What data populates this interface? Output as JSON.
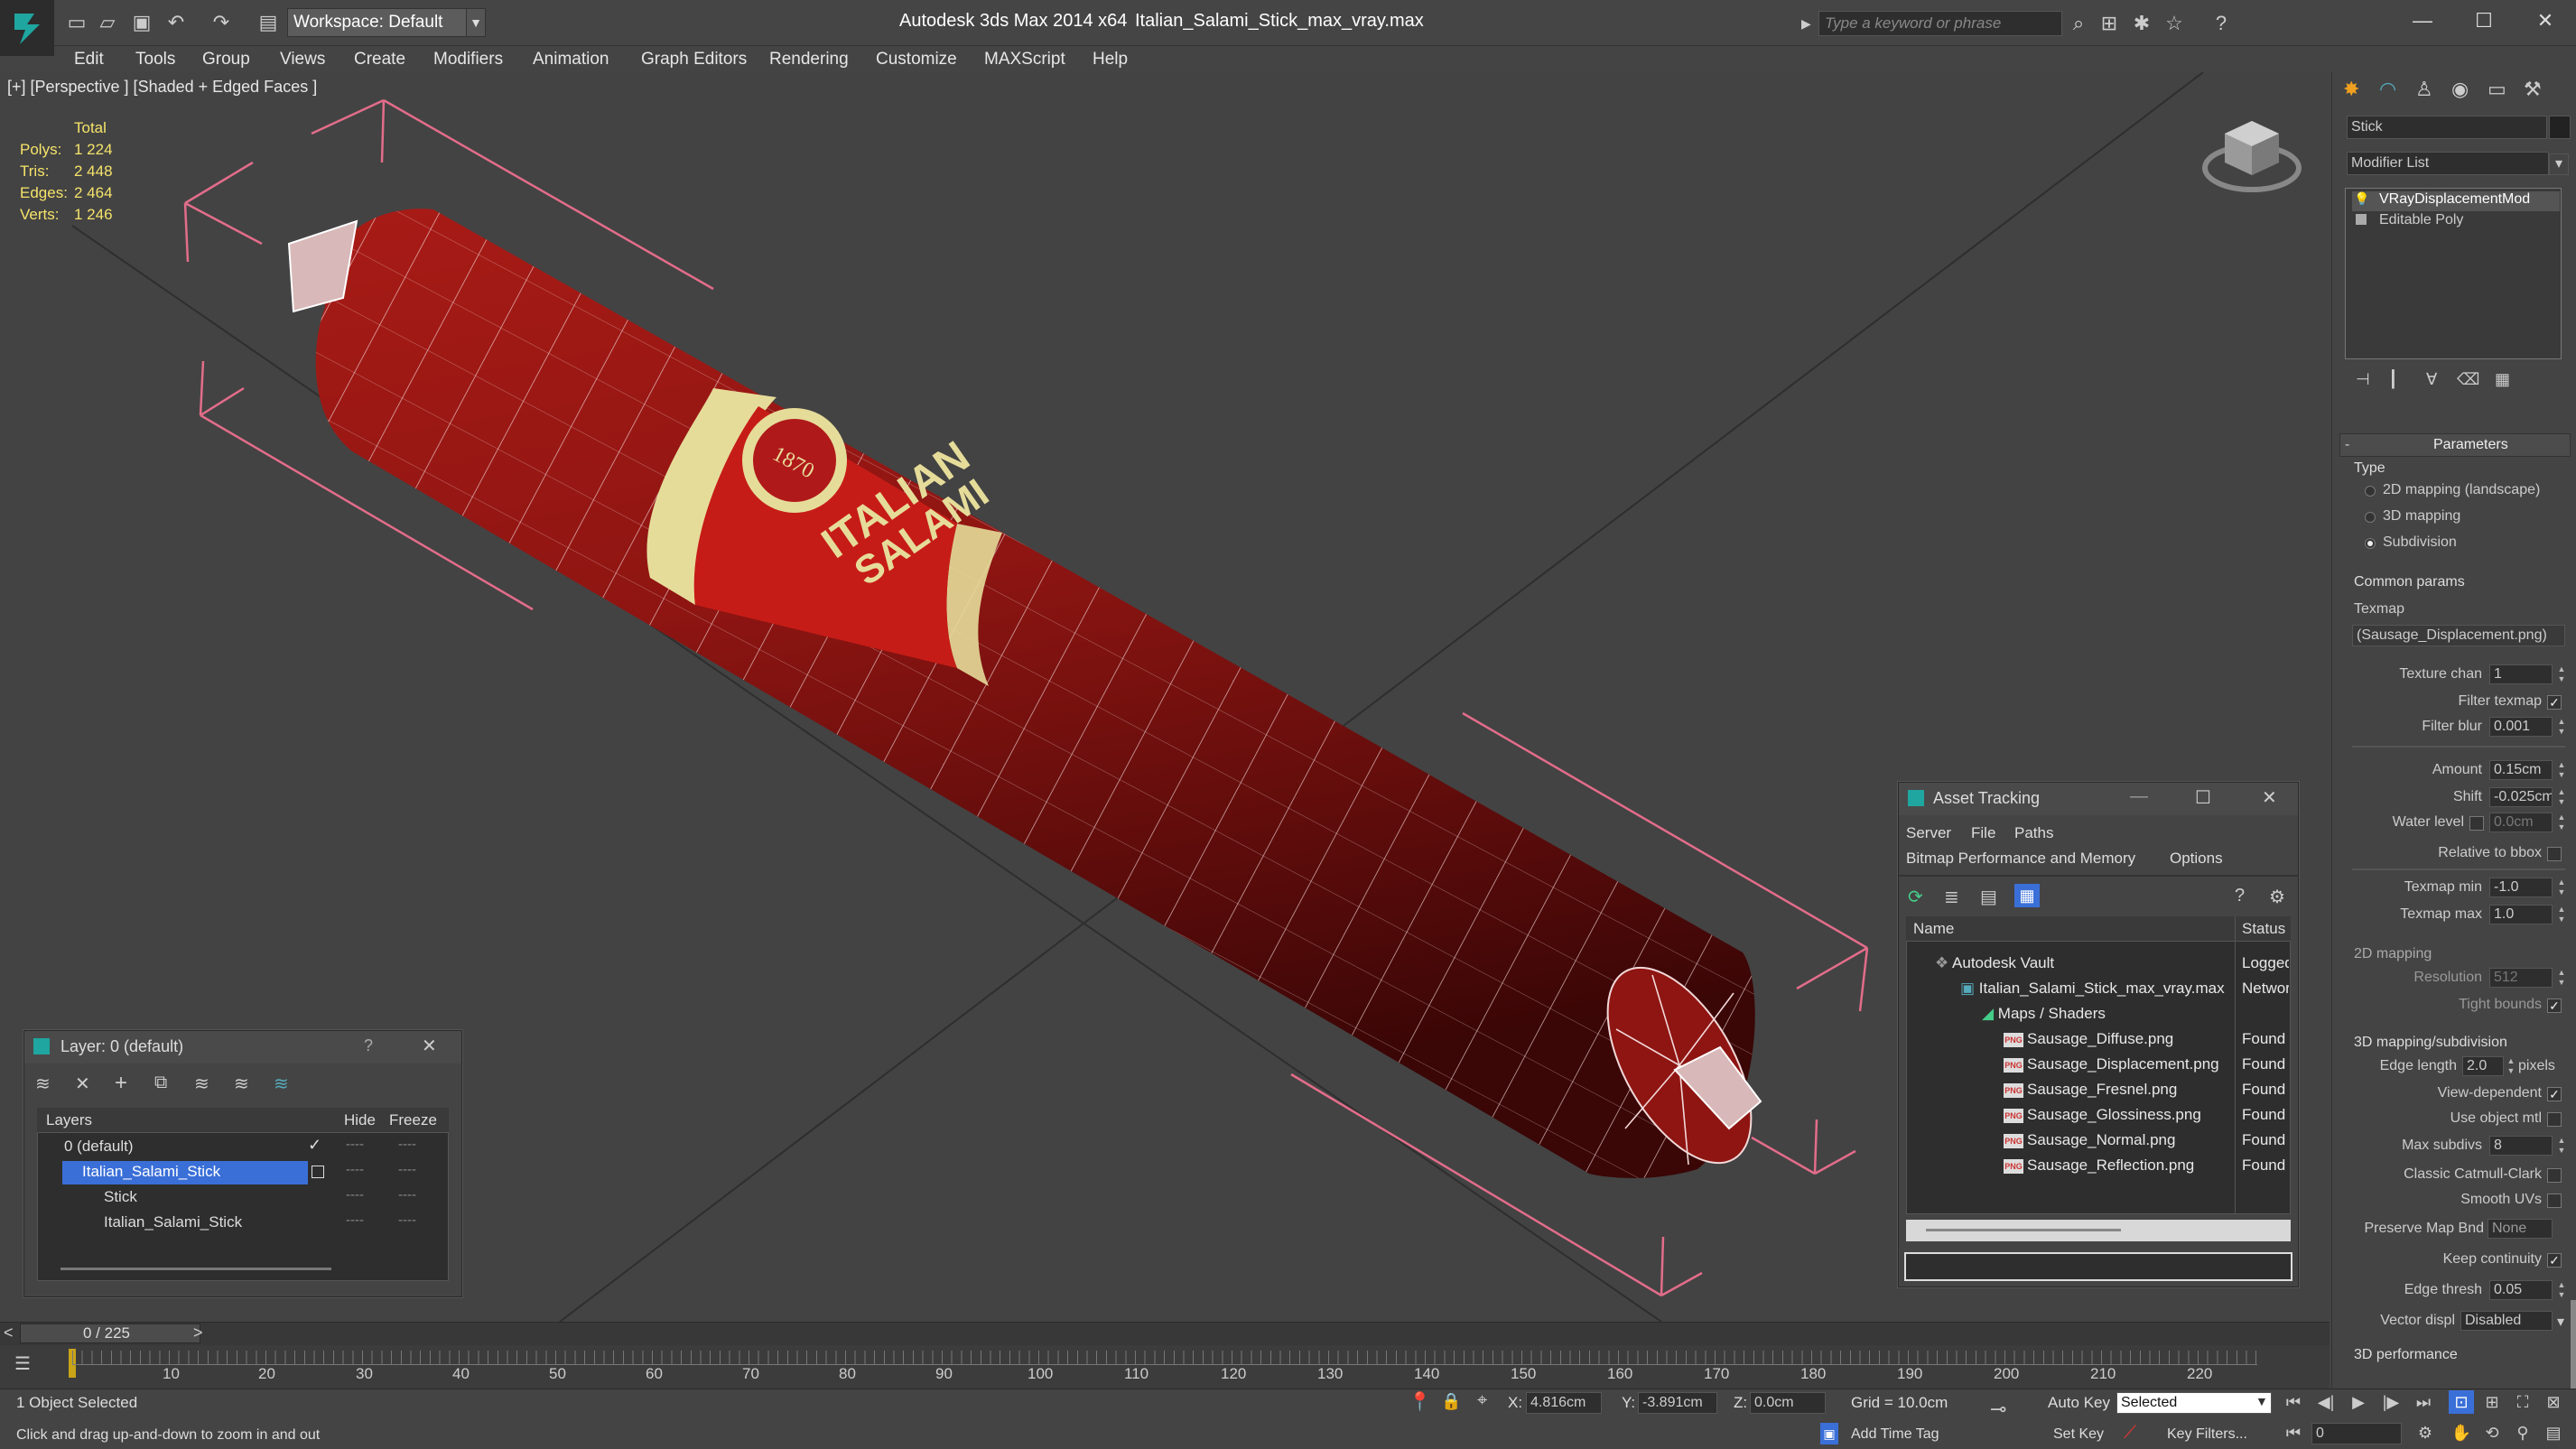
{
  "window": {
    "app_title": "Autodesk 3ds Max  2014 x64",
    "file_title": "Italian_Salami_Stick_max_vray.max",
    "workspace": "Workspace: Default",
    "search_placeholder": "Type a keyword or phrase"
  },
  "menu": [
    "Edit",
    "Tools",
    "Group",
    "Views",
    "Create",
    "Modifiers",
    "Animation",
    "Graph Editors",
    "Rendering",
    "Customize",
    "MAXScript",
    "Help"
  ],
  "viewport": {
    "label": "[+] [Perspective ] [Shaded + Edged Faces ]",
    "stats": {
      "header": "Total",
      "rows": [
        {
          "label": "Polys:",
          "value": "1 224"
        },
        {
          "label": "Tris:",
          "value": "2 448"
        },
        {
          "label": "Edges:",
          "value": "2 464"
        },
        {
          "label": "Verts:",
          "value": "1 246"
        }
      ]
    },
    "product_label_1": "ITALIAN",
    "product_label_2": "SALAMI",
    "seal_text": "1870"
  },
  "command_panel": {
    "object_name": "Stick",
    "modifier_list": "Modifier List",
    "stack": [
      "VRayDisplacementMod",
      "Editable Poly"
    ],
    "parameters_title": "Parameters",
    "type_label": "Type",
    "type_options": [
      "2D mapping (landscape)",
      "3D mapping",
      "Subdivision"
    ],
    "common_params": "Common params",
    "texmap_label": "Texmap",
    "texmap_value": "(Sausage_Displacement.png)",
    "texture_chan_label": "Texture chan",
    "texture_chan_value": "1",
    "filter_texmap_label": "Filter texmap",
    "filter_blur_label": "Filter blur",
    "filter_blur_value": "0.001",
    "amount_label": "Amount",
    "amount_value": "0.15cm",
    "shift_label": "Shift",
    "shift_value": "-0.025cm",
    "water_level_label": "Water level",
    "water_level_value": "0.0cm",
    "relative_bbox_label": "Relative to bbox",
    "texmap_min_label": "Texmap min",
    "texmap_min_value": "-1.0",
    "texmap_max_label": "Texmap max",
    "texmap_max_value": "1.0",
    "mapping2d_title": "2D mapping",
    "resolution_label": "Resolution",
    "resolution_value": "512",
    "tight_bounds_label": "Tight bounds",
    "mapping3d_title": "3D mapping/subdivision",
    "edge_length_label": "Edge length",
    "edge_length_value": "2.0",
    "pixels_label": "pixels",
    "view_dependent_label": "View-dependent",
    "use_object_mtl_label": "Use object mtl",
    "max_subdivs_label": "Max subdivs",
    "max_subdivs_value": "8",
    "classic_catmull_label": "Classic Catmull-Clark",
    "smooth_uvs_label": "Smooth UVs",
    "preserve_map_label": "Preserve Map Bnd",
    "preserve_map_value": "None",
    "keep_continuity_label": "Keep continuity",
    "edge_thresh_label": "Edge thresh",
    "edge_thresh_value": "0.05",
    "vector_displ_label": "Vector displ",
    "vector_displ_value": "Disabled",
    "performance_title": "3D performance"
  },
  "layer_dialog": {
    "title": "Layer: 0 (default)",
    "help": "?",
    "col_layers": "Layers",
    "col_hide": "Hide",
    "col_freeze": "Freeze",
    "rows": [
      "0 (default)",
      "Italian_Salami_Stick",
      "Stick",
      "Italian_Salami_Stick"
    ],
    "dash": "----"
  },
  "asset_dialog": {
    "title": "Asset Tracking",
    "menu": [
      "Server",
      "File",
      "Paths"
    ],
    "menu2": [
      "Bitmap Performance and Memory",
      "Options"
    ],
    "col_name": "Name",
    "col_status": "Status",
    "rows": [
      {
        "name": "Autodesk Vault",
        "status": "Logged"
      },
      {
        "name": "Italian_Salami_Stick_max_vray.max",
        "status": "Network"
      },
      {
        "name": "Maps / Shaders",
        "status": ""
      },
      {
        "name": "Sausage_Diffuse.png",
        "status": "Found"
      },
      {
        "name": "Sausage_Displacement.png",
        "status": "Found"
      },
      {
        "name": "Sausage_Fresnel.png",
        "status": "Found"
      },
      {
        "name": "Sausage_Glossiness.png",
        "status": "Found"
      },
      {
        "name": "Sausage_Normal.png",
        "status": "Found"
      },
      {
        "name": "Sausage_Reflection.png",
        "status": "Found"
      }
    ],
    "png_badge": "PNG"
  },
  "timeline": {
    "frame": "0 / 225",
    "ticks": [
      "10",
      "20",
      "30",
      "40",
      "50",
      "60",
      "70",
      "80",
      "90",
      "100",
      "110",
      "120",
      "130",
      "140",
      "150",
      "160",
      "170",
      "180",
      "190",
      "200",
      "210",
      "220"
    ]
  },
  "status": {
    "selected": "1 Object Selected",
    "hint": "Click and drag up-and-down to zoom in and out",
    "x_label": "X:",
    "x_value": "4.816cm",
    "y_label": "Y:",
    "y_value": "-3.891cm",
    "z_label": "Z:",
    "z_value": "0.0cm",
    "grid": "Grid = 10.0cm",
    "auto_key": "Auto Key",
    "selected_dropdown": "Selected",
    "set_key": "Set Key",
    "key_filters": "Key Filters...",
    "add_time_tag": "Add Time Tag",
    "frame_value": "0"
  },
  "colors": {
    "accent": "#3a6fd8",
    "stat_yellow": "#f5e36a",
    "sausage": "#8e1512",
    "label_cream": "#e6dc9a",
    "bbox_pink": "#e36d8a"
  }
}
